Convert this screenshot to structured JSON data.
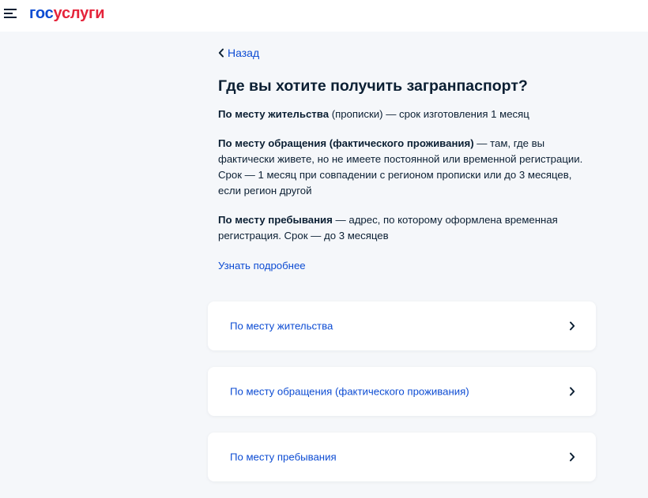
{
  "header": {
    "menu_icon": "burger-menu-icon",
    "logo": {
      "part1": "гос",
      "part2": "услуги"
    }
  },
  "nav": {
    "back_label": "Назад",
    "back_icon": "chevron-left-icon"
  },
  "page": {
    "title": "Где вы хотите получить загранпаспорт?"
  },
  "info": [
    {
      "bold": "По месту жительства",
      "text": " (прописки) — срок изготовления 1 месяц"
    },
    {
      "bold": "По месту обращения (фактического проживания)",
      "text": " — там, где вы фактически живете, но не имеете постоянной или временной регистрации. Срок — 1 месяц при совпадении с регионом прописки или до 3 месяцев, если регион другой"
    },
    {
      "bold": "По месту пребывания",
      "text": " — адрес, по которому оформлена временная регистрация. Срок — до 3 месяцев"
    }
  ],
  "more_link": "Узнать подробнее",
  "options": [
    {
      "label": "По месту жительства",
      "icon": "chevron-right-icon"
    },
    {
      "label": "По месту обращения (фактического проживания)",
      "icon": "chevron-right-icon"
    },
    {
      "label": "По месту пребывания",
      "icon": "chevron-right-icon"
    }
  ],
  "colors": {
    "brand_blue": "#0d4cd3",
    "brand_red": "#e5243b",
    "text_dark": "#0b1f33",
    "background": "#f5f7fa"
  }
}
